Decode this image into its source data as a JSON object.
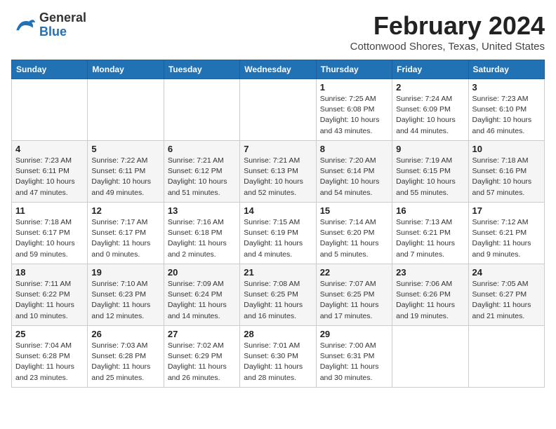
{
  "header": {
    "logo_general": "General",
    "logo_blue": "Blue",
    "title": "February 2024",
    "subtitle": "Cottonwood Shores, Texas, United States"
  },
  "weekdays": [
    "Sunday",
    "Monday",
    "Tuesday",
    "Wednesday",
    "Thursday",
    "Friday",
    "Saturday"
  ],
  "weeks": [
    [
      {
        "num": "",
        "info": ""
      },
      {
        "num": "",
        "info": ""
      },
      {
        "num": "",
        "info": ""
      },
      {
        "num": "",
        "info": ""
      },
      {
        "num": "1",
        "info": "Sunrise: 7:25 AM\nSunset: 6:08 PM\nDaylight: 10 hours\nand 43 minutes."
      },
      {
        "num": "2",
        "info": "Sunrise: 7:24 AM\nSunset: 6:09 PM\nDaylight: 10 hours\nand 44 minutes."
      },
      {
        "num": "3",
        "info": "Sunrise: 7:23 AM\nSunset: 6:10 PM\nDaylight: 10 hours\nand 46 minutes."
      }
    ],
    [
      {
        "num": "4",
        "info": "Sunrise: 7:23 AM\nSunset: 6:11 PM\nDaylight: 10 hours\nand 47 minutes."
      },
      {
        "num": "5",
        "info": "Sunrise: 7:22 AM\nSunset: 6:11 PM\nDaylight: 10 hours\nand 49 minutes."
      },
      {
        "num": "6",
        "info": "Sunrise: 7:21 AM\nSunset: 6:12 PM\nDaylight: 10 hours\nand 51 minutes."
      },
      {
        "num": "7",
        "info": "Sunrise: 7:21 AM\nSunset: 6:13 PM\nDaylight: 10 hours\nand 52 minutes."
      },
      {
        "num": "8",
        "info": "Sunrise: 7:20 AM\nSunset: 6:14 PM\nDaylight: 10 hours\nand 54 minutes."
      },
      {
        "num": "9",
        "info": "Sunrise: 7:19 AM\nSunset: 6:15 PM\nDaylight: 10 hours\nand 55 minutes."
      },
      {
        "num": "10",
        "info": "Sunrise: 7:18 AM\nSunset: 6:16 PM\nDaylight: 10 hours\nand 57 minutes."
      }
    ],
    [
      {
        "num": "11",
        "info": "Sunrise: 7:18 AM\nSunset: 6:17 PM\nDaylight: 10 hours\nand 59 minutes."
      },
      {
        "num": "12",
        "info": "Sunrise: 7:17 AM\nSunset: 6:17 PM\nDaylight: 11 hours\nand 0 minutes."
      },
      {
        "num": "13",
        "info": "Sunrise: 7:16 AM\nSunset: 6:18 PM\nDaylight: 11 hours\nand 2 minutes."
      },
      {
        "num": "14",
        "info": "Sunrise: 7:15 AM\nSunset: 6:19 PM\nDaylight: 11 hours\nand 4 minutes."
      },
      {
        "num": "15",
        "info": "Sunrise: 7:14 AM\nSunset: 6:20 PM\nDaylight: 11 hours\nand 5 minutes."
      },
      {
        "num": "16",
        "info": "Sunrise: 7:13 AM\nSunset: 6:21 PM\nDaylight: 11 hours\nand 7 minutes."
      },
      {
        "num": "17",
        "info": "Sunrise: 7:12 AM\nSunset: 6:21 PM\nDaylight: 11 hours\nand 9 minutes."
      }
    ],
    [
      {
        "num": "18",
        "info": "Sunrise: 7:11 AM\nSunset: 6:22 PM\nDaylight: 11 hours\nand 10 minutes."
      },
      {
        "num": "19",
        "info": "Sunrise: 7:10 AM\nSunset: 6:23 PM\nDaylight: 11 hours\nand 12 minutes."
      },
      {
        "num": "20",
        "info": "Sunrise: 7:09 AM\nSunset: 6:24 PM\nDaylight: 11 hours\nand 14 minutes."
      },
      {
        "num": "21",
        "info": "Sunrise: 7:08 AM\nSunset: 6:25 PM\nDaylight: 11 hours\nand 16 minutes."
      },
      {
        "num": "22",
        "info": "Sunrise: 7:07 AM\nSunset: 6:25 PM\nDaylight: 11 hours\nand 17 minutes."
      },
      {
        "num": "23",
        "info": "Sunrise: 7:06 AM\nSunset: 6:26 PM\nDaylight: 11 hours\nand 19 minutes."
      },
      {
        "num": "24",
        "info": "Sunrise: 7:05 AM\nSunset: 6:27 PM\nDaylight: 11 hours\nand 21 minutes."
      }
    ],
    [
      {
        "num": "25",
        "info": "Sunrise: 7:04 AM\nSunset: 6:28 PM\nDaylight: 11 hours\nand 23 minutes."
      },
      {
        "num": "26",
        "info": "Sunrise: 7:03 AM\nSunset: 6:28 PM\nDaylight: 11 hours\nand 25 minutes."
      },
      {
        "num": "27",
        "info": "Sunrise: 7:02 AM\nSunset: 6:29 PM\nDaylight: 11 hours\nand 26 minutes."
      },
      {
        "num": "28",
        "info": "Sunrise: 7:01 AM\nSunset: 6:30 PM\nDaylight: 11 hours\nand 28 minutes."
      },
      {
        "num": "29",
        "info": "Sunrise: 7:00 AM\nSunset: 6:31 PM\nDaylight: 11 hours\nand 30 minutes."
      },
      {
        "num": "",
        "info": ""
      },
      {
        "num": "",
        "info": ""
      }
    ]
  ]
}
